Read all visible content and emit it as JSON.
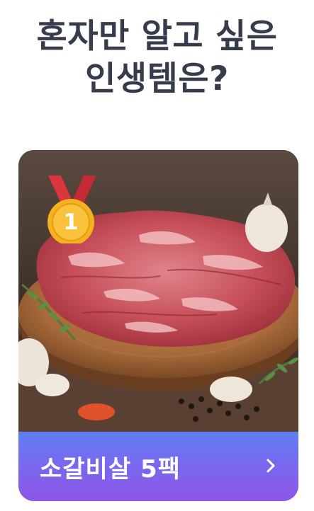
{
  "headline": {
    "line1": "혼자만 알고 싶은",
    "line2": "인생템은?"
  },
  "product": {
    "rank": "1",
    "name": "소갈비살 5팩",
    "image_alt": "소갈비살 5팩",
    "rank_icon": "medal-icon",
    "arrow_icon": "chevron-right-icon"
  },
  "colors": {
    "headline": "#363c4b",
    "cta_gradient_top": "#5f7ff5",
    "cta_gradient_bottom": "#8d56e6",
    "medal_gold": "#f5b21f",
    "medal_ribbon": "#d9363e"
  }
}
